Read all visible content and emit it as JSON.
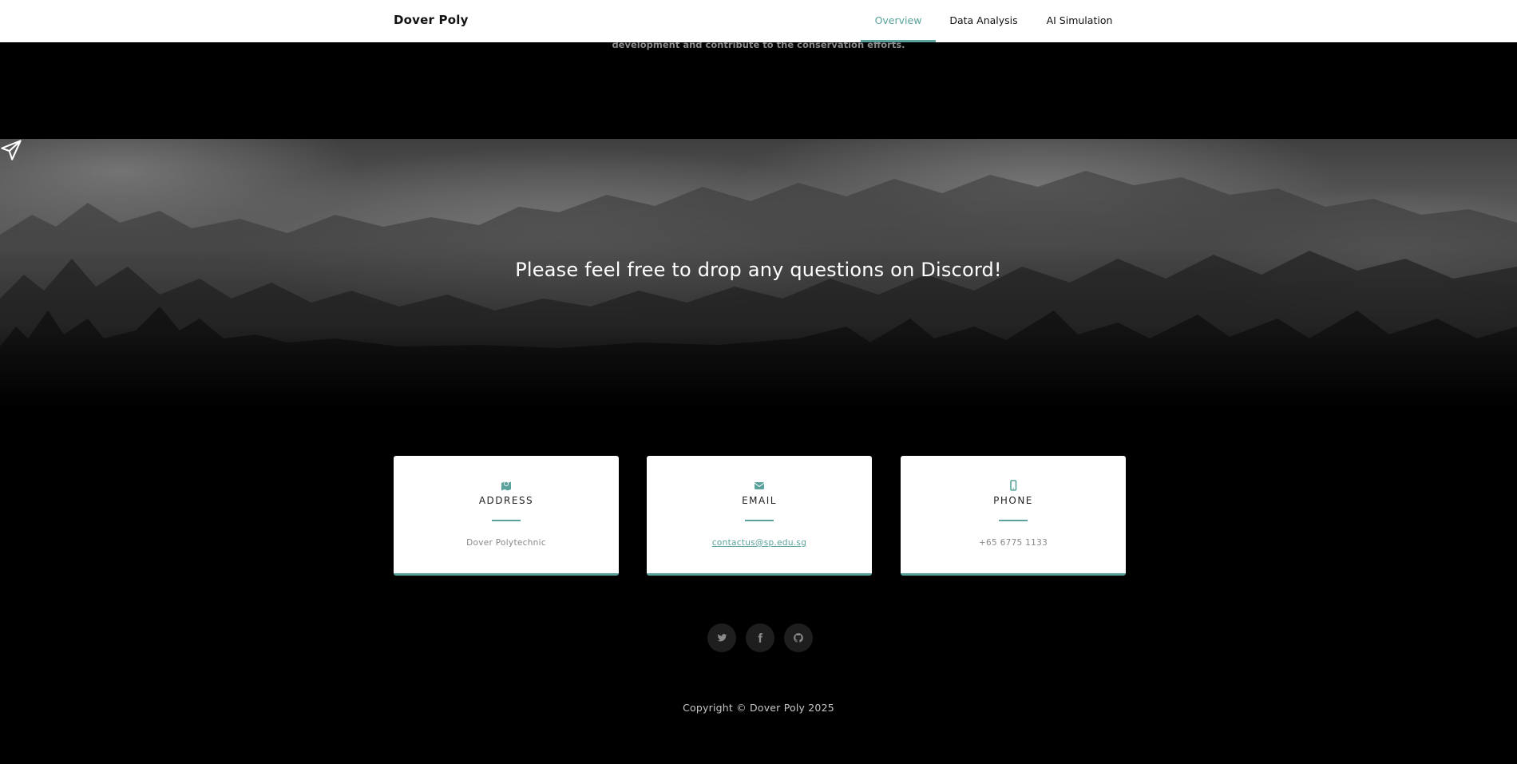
{
  "nav": {
    "brand": "Dover Poly",
    "links": [
      "Overview",
      "Data Analysis",
      "AI Simulation"
    ],
    "active_link": "Overview"
  },
  "hero": {
    "cut_text": "development and contribute to the conservation efforts."
  },
  "banner": {
    "icon": "paper-plane-icon",
    "title": "Please feel free to drop any questions on Discord!"
  },
  "contact": {
    "cards": [
      {
        "icon": "map-icon",
        "title": "ADDRESS",
        "value": "Dover Polytechnic"
      },
      {
        "icon": "envelope-icon",
        "title": "EMAIL",
        "value": "contactus@sp.edu.sg"
      },
      {
        "icon": "mobile-icon",
        "title": "PHONE",
        "value": "+65 6775 1133"
      }
    ]
  },
  "social": {
    "icons": [
      "twitter-icon",
      "facebook-icon",
      "github-icon"
    ]
  },
  "footer": {
    "copyright": "Copyright © Dover Poly 2025"
  },
  "colors": {
    "accent": "#5aa29b",
    "background": "#000000",
    "navbar": "#ffffff"
  }
}
